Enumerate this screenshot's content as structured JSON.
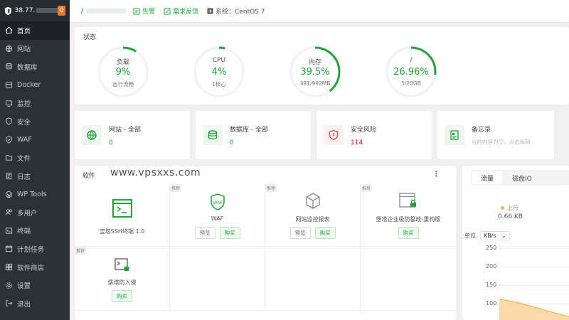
{
  "sidebar": {
    "ip": "38.77.",
    "badge": "0",
    "items": [
      {
        "label": "首页",
        "icon": "home-icon"
      },
      {
        "label": "网站",
        "icon": "globe-icon"
      },
      {
        "label": "数据库",
        "icon": "database-icon"
      },
      {
        "label": "Docker",
        "icon": "docker-icon"
      },
      {
        "label": "监控",
        "icon": "monitor-icon"
      },
      {
        "label": "安全",
        "icon": "shield-icon"
      },
      {
        "label": "WAF",
        "icon": "shield-icon"
      },
      {
        "label": "文件",
        "icon": "folder-icon"
      },
      {
        "label": "日志",
        "icon": "log-icon"
      },
      {
        "label": "WP Tools",
        "icon": "wordpress-icon"
      },
      {
        "label": "多用户",
        "icon": "users-icon"
      },
      {
        "label": "终端",
        "icon": "terminal-icon"
      },
      {
        "label": "计划任务",
        "icon": "calendar-icon"
      },
      {
        "label": "软件商店",
        "icon": "store-icon"
      },
      {
        "label": "设置",
        "icon": "gear-icon"
      },
      {
        "label": "退出",
        "icon": "logout-icon"
      }
    ]
  },
  "topbar": {
    "user_prefix": "/",
    "notice": "告警",
    "feedback": "需求反馈",
    "system": "系统：CentOS 7"
  },
  "status": {
    "title": "状态",
    "gauges": [
      {
        "name": "负载",
        "value": "9%",
        "sub": "运行流畅",
        "percent": 9
      },
      {
        "name": "CPU",
        "value": "4%",
        "sub": "1核心",
        "percent": 4
      },
      {
        "name": "内存",
        "value": "39.5%",
        "sub": "391/992MB",
        "percent": 39.5
      },
      {
        "name": "/",
        "value": "26.96%",
        "sub": "5/20GB",
        "percent": 26.96
      }
    ]
  },
  "cards": [
    {
      "title": "网站 - 全部",
      "value": "0",
      "icon": "globe-icon"
    },
    {
      "title": "数据库 - 全部",
      "value": "0",
      "icon": "database-icon"
    },
    {
      "title": "安全风险",
      "value": "114",
      "icon": "shield-alert-icon"
    },
    {
      "title": "备忘录",
      "value": "当前内容为空，点击编辑",
      "icon": "memo-icon"
    }
  ],
  "software": {
    "title": "软件",
    "watermark": "www.vpsxxs.com",
    "more": "⋮",
    "items": [
      {
        "name": "宝塔SSH终端 1.0",
        "tag": "",
        "buttons": []
      },
      {
        "name": "WAF",
        "tag": "推荐",
        "buttons": [
          "预览",
          "购买"
        ]
      },
      {
        "name": "网站监控报表",
        "tag": "推荐",
        "buttons": [
          "预览",
          "购买"
        ]
      },
      {
        "name": "堡塔企业级防篡改-重构版",
        "tag": "推荐",
        "buttons": [
          "购买"
        ]
      },
      {
        "name": "堡塔防入侵",
        "tag": "推荐",
        "buttons": [
          "购买"
        ]
      }
    ]
  },
  "traffic": {
    "tabs": [
      "流量",
      "磁盘IO"
    ],
    "upload_label": "上行",
    "upload_value": "0.66 KB",
    "unit_label": "单位",
    "unit_value": "KB/s",
    "y_ticks": [
      "250",
      "200",
      "150",
      "100"
    ]
  },
  "colors": {
    "accent": "#20a53a",
    "danger": "#ef0808",
    "sidebar": "#2c3138"
  }
}
